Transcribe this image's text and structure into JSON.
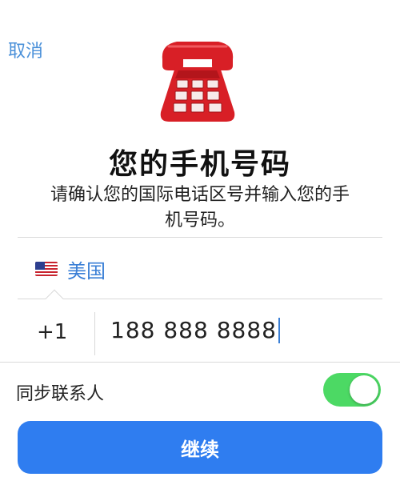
{
  "header": {
    "cancel_label": "取消"
  },
  "icon": {
    "name": "telephone-icon",
    "color": "#d81f26"
  },
  "title": "您的手机号码",
  "subtitle": "请确认您的国际电话区号并输入您的手机号码。",
  "country": {
    "flag": "us-flag-icon",
    "name": "美国"
  },
  "phone": {
    "country_code": "+1",
    "number": "188 888 8888"
  },
  "sync_contacts": {
    "label": "同步联系人",
    "enabled": true
  },
  "continue_label": "继续",
  "colors": {
    "link": "#4a90d9",
    "accent": "#2f7df0",
    "toggle_on": "#4cd964"
  }
}
